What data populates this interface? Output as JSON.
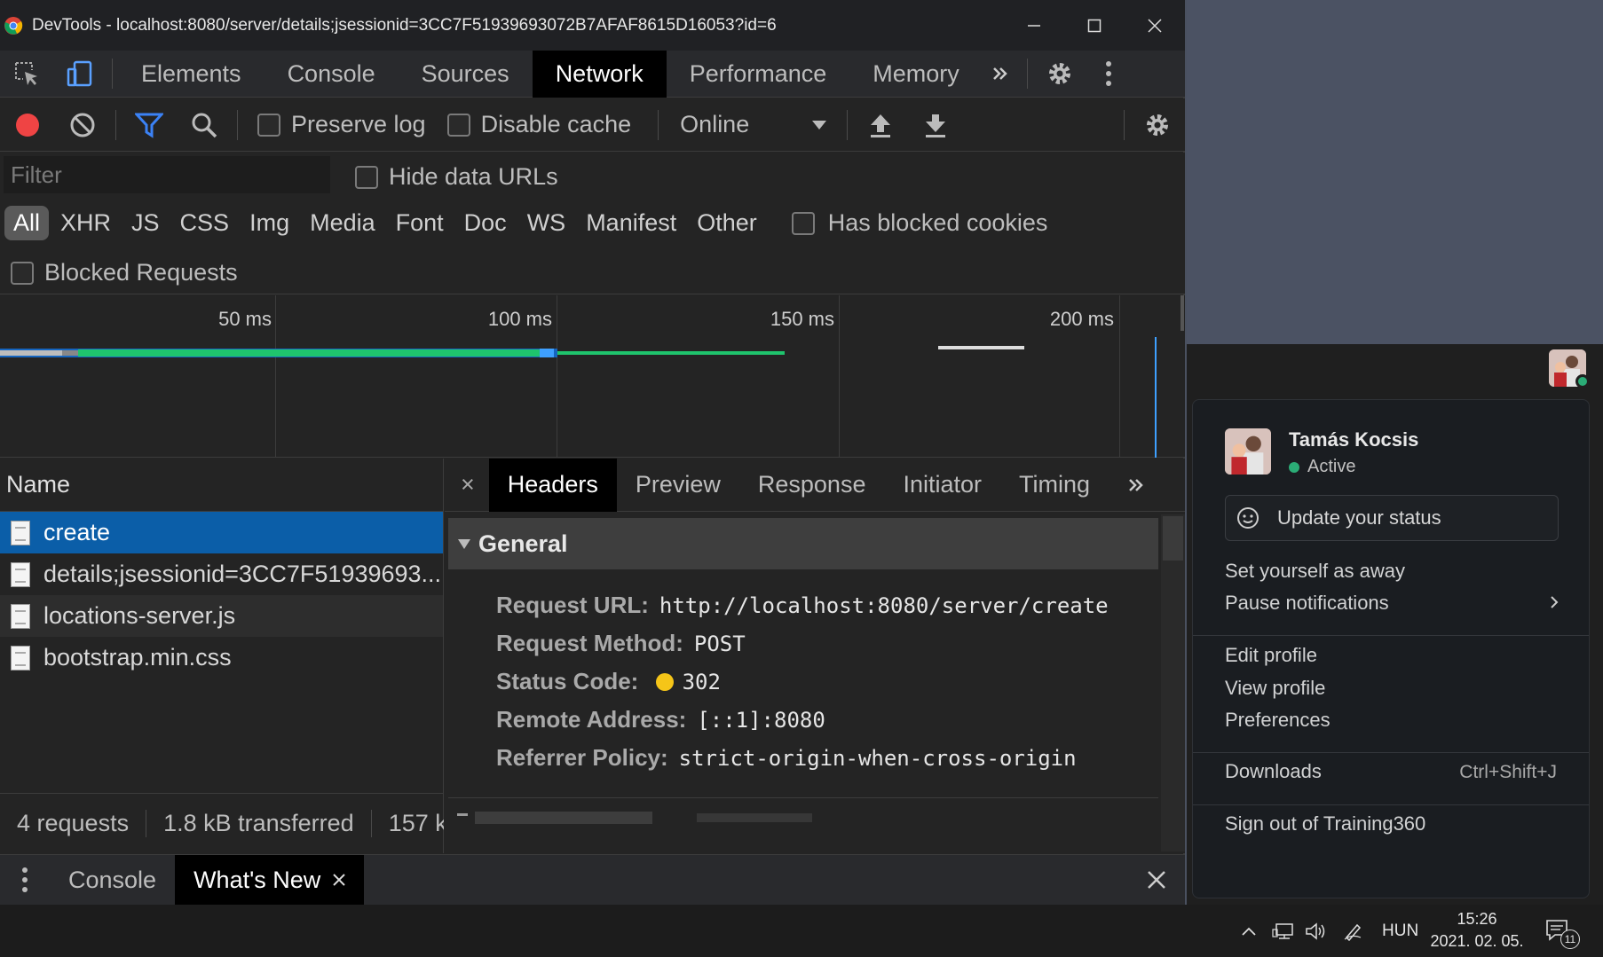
{
  "window": {
    "title": "DevTools - localhost:8080/server/details;jsessionid=3CC7F51939693072B7AFAF8615D16053?id=6"
  },
  "main_tabs": [
    {
      "label": "Elements"
    },
    {
      "label": "Console"
    },
    {
      "label": "Sources"
    },
    {
      "label": "Network",
      "active": true
    },
    {
      "label": "Performance"
    },
    {
      "label": "Memory"
    }
  ],
  "toolbar": {
    "preserve_log": "Preserve log",
    "disable_cache": "Disable cache",
    "throttling": "Online"
  },
  "filter": {
    "placeholder": "Filter",
    "hide_data_urls": "Hide data URLs",
    "types": [
      "All",
      "XHR",
      "JS",
      "CSS",
      "Img",
      "Media",
      "Font",
      "Doc",
      "WS",
      "Manifest",
      "Other"
    ],
    "has_blocked_cookies": "Has blocked cookies",
    "blocked_requests": "Blocked Requests"
  },
  "timeline": {
    "ticks": [
      "50 ms",
      "100 ms",
      "150 ms",
      "200 ms"
    ]
  },
  "requests": {
    "header": "Name",
    "items": [
      {
        "name": "create"
      },
      {
        "name": "details;jsessionid=3CC7F51939693..."
      },
      {
        "name": "locations-server.js"
      },
      {
        "name": "bootstrap.min.css"
      }
    ],
    "status": {
      "requests": "4 requests",
      "transferred": "1.8 kB transferred",
      "resources": "157 k"
    }
  },
  "details": {
    "tabs": [
      "Headers",
      "Preview",
      "Response",
      "Initiator",
      "Timing"
    ],
    "close": "×",
    "general_title": "General",
    "rows": [
      {
        "key": "Request URL:",
        "value": "http://localhost:8080/server/create"
      },
      {
        "key": "Request Method:",
        "value": "POST"
      },
      {
        "key": "Status Code:",
        "value": "302"
      },
      {
        "key": "Remote Address:",
        "value": "[::1]:8080"
      },
      {
        "key": "Referrer Policy:",
        "value": "strict-origin-when-cross-origin"
      }
    ],
    "status_color": "#f5c518"
  },
  "drawer": {
    "tabs": [
      "Console",
      "What's New"
    ],
    "close": "×"
  },
  "profile_menu": {
    "name": "Tamás Kocsis",
    "status": "Active",
    "update_status": "Update your status",
    "set_away": "Set yourself as away",
    "pause_notifications": "Pause notifications",
    "edit_profile": "Edit profile",
    "view_profile": "View profile",
    "preferences": "Preferences",
    "downloads": "Downloads",
    "downloads_shortcut": "Ctrl+Shift+J",
    "sign_out": "Sign out of Training360"
  },
  "taskbar": {
    "language": "HUN",
    "time": "15:26",
    "date": "2021. 02. 05.",
    "notifications": "11"
  },
  "colors": {
    "network_active": "#000000",
    "selected_row": "#0b5ea8",
    "record": "#ef4444",
    "filter_icon": "#3b82f6",
    "presence": "#2bac76"
  }
}
